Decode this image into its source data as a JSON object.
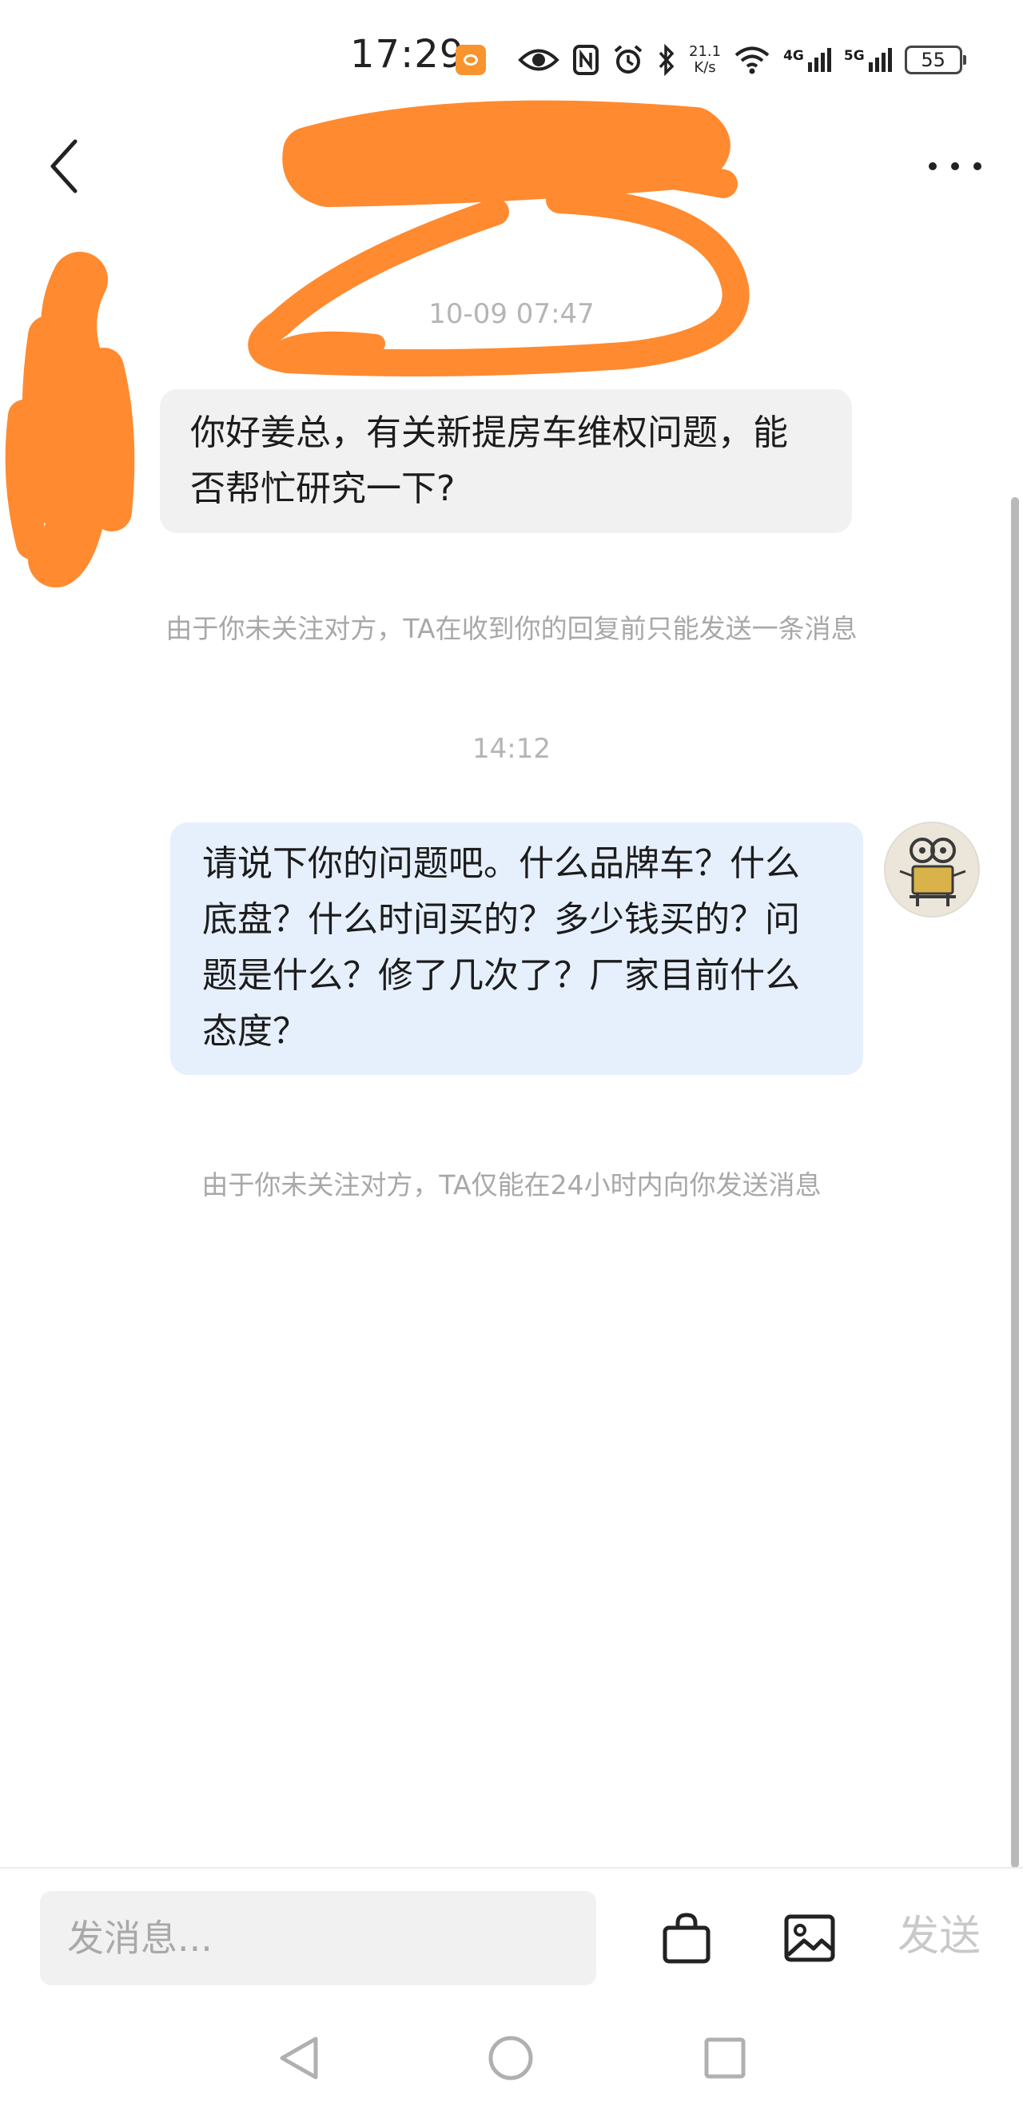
{
  "status_bar": {
    "time": "17:29",
    "net_speed_value": "21.1",
    "net_speed_unit": "K/s",
    "signal_1": "4G",
    "signal_2": "5G",
    "battery": "55"
  },
  "header": {
    "title": "",
    "icons": [
      "back-arrow-icon",
      "more-dots-icon"
    ]
  },
  "chat": {
    "messages": [
      {
        "timestamp": "10-09 07:47",
        "direction": "incoming",
        "text": "你好姜总，有关新提房车维权问题，能否帮忙研究一下?",
        "note": "由于你未关注对方，TA在收到你的回复前只能发送一条消息"
      },
      {
        "timestamp": "14:12",
        "direction": "outgoing",
        "text": "请说下你的问题吧。什么品牌车？什么底盘？什么时间买的？多少钱买的？问题是什么？修了几次了？厂家目前什么态度？",
        "note": "由于你未关注对方，TA仅能在24小时内向你发送消息"
      }
    ]
  },
  "input_bar": {
    "placeholder": "发消息...",
    "value": "",
    "send_label": "发送",
    "icons": [
      "shopping-bag-icon",
      "image-icon"
    ]
  },
  "colors": {
    "scribble": "#ff8a30",
    "incoming_bubble": "#f1f1f1",
    "outgoing_bubble": "#e6f0fd",
    "muted_text": "#a8a8a8"
  }
}
